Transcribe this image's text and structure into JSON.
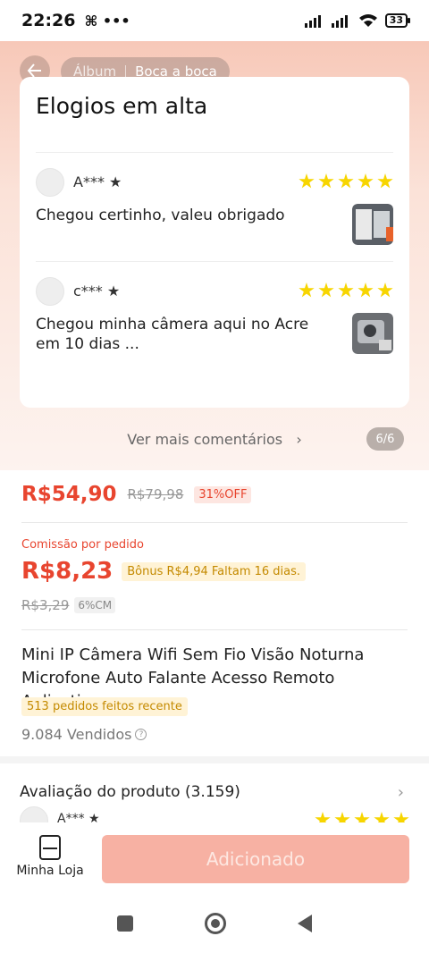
{
  "status_bar": {
    "time": "22:26",
    "extra_icons": "⌘ •••",
    "battery": "33"
  },
  "header": {
    "tabs": [
      "Álbum",
      "Boca a boca"
    ]
  },
  "reviews_card": {
    "title": "Elogios em alta",
    "reviews": [
      {
        "user": "A*** ★",
        "text": "Chegou certinho, valeu obrigado",
        "stars": 5
      },
      {
        "user": "c*** ★",
        "text": "Chegou minha câmera aqui no Acre em 10 dias ...",
        "stars": 5
      }
    ]
  },
  "more_comments": "Ver mais comentários",
  "pager": "6/6",
  "price": {
    "current": "R$54,90",
    "original": "R$79,98",
    "discount": "31%OFF"
  },
  "commission": {
    "label": "Comissão por pedido",
    "value": "R$8,23",
    "bonus": "Bônus R$4,94   Faltam 16 dias.",
    "old_value": "R$3,29",
    "rate": "6%CM"
  },
  "product": {
    "title": "Mini IP Câmera Wifi Sem Fio Visão Noturna Microfone Auto Falante Acesso Remoto Aplicativo",
    "orders_badge": "513 pedidos feitos recente",
    "sold": "9.084 Vendidos"
  },
  "rating": {
    "title": "Avaliação do produto (3.159)",
    "peek_user": "A*** ★"
  },
  "bottom_bar": {
    "store_label": "Minha Loja",
    "add_label": "Adicionado"
  },
  "colors": {
    "accent": "#e8452f",
    "button": "#f7b1a3",
    "star": "#f7d500"
  }
}
